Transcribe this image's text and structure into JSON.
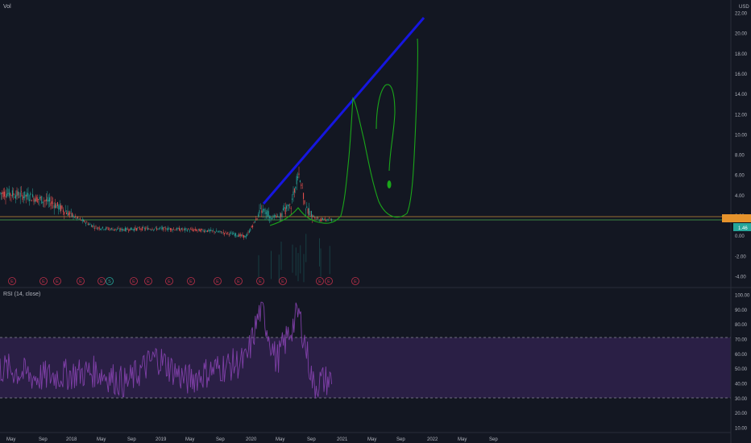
{
  "header": {
    "symbol": "Vol",
    "currency": "USD"
  },
  "price_axis": {
    "labels": [
      "22.00",
      "20.00",
      "18.00",
      "16.00",
      "14.00",
      "12.00",
      "10.00",
      "8.00",
      "6.00",
      "4.00",
      "2.00",
      "0.00",
      "-2.00",
      "-4.00"
    ],
    "current_price_tag": "",
    "current_change_tag": "1.46"
  },
  "rsi": {
    "title": "RSI (14, close)",
    "axis_labels": [
      "100.00",
      "90.00",
      "80.00",
      "70.00",
      "60.00",
      "50.00",
      "40.00",
      "30.00",
      "20.00",
      "10.00"
    ]
  },
  "time_axis": {
    "labels": [
      "May",
      "Sep",
      "2018",
      "May",
      "Sep",
      "2019",
      "May",
      "Sep",
      "2020",
      "May",
      "Sep",
      "2021",
      "May",
      "Sep",
      "2022",
      "May",
      "Sep"
    ]
  },
  "events": {
    "earnings_marker_label": "E",
    "split_marker_label": "S",
    "markers": [
      "E",
      "E",
      "E",
      "E",
      "E",
      "S",
      "E",
      "E",
      "E",
      "E",
      "E",
      "E",
      "E",
      "E",
      "E",
      "E",
      "E"
    ]
  },
  "colors": {
    "background": "#131722",
    "trend_line": "#1616e0",
    "drawing": "#1aa61a",
    "rsi_band": "#2a1f45",
    "rsi_line": "#7e3fa6",
    "up_candle": "#26a69a",
    "down_candle": "#ef5350",
    "marker_red": "#c0304a"
  },
  "chart_data": [
    {
      "type": "candlestick",
      "title": "",
      "ylabel": "USD",
      "ylim": [
        -4,
        22
      ],
      "x_range": [
        "2017-05",
        "2022-10"
      ],
      "grid": false,
      "approx_close_series": {
        "x": [
          "2017-05",
          "2017-08",
          "2017-11",
          "2018-02",
          "2018-05",
          "2018-08",
          "2018-11",
          "2019-02",
          "2019-05",
          "2019-08",
          "2019-11",
          "2020-01",
          "2020-03",
          "2020-05",
          "2020-07",
          "2020-08",
          "2020-09",
          "2020-10",
          "2020-11"
        ],
        "y": [
          4.2,
          3.9,
          3.3,
          1.9,
          0.8,
          0.6,
          0.7,
          0.7,
          0.6,
          0.5,
          0.2,
          -0.1,
          2.5,
          1.8,
          3.0,
          6.5,
          2.6,
          1.9,
          1.6
        ]
      },
      "horizontal_lines": [
        2.0,
        1.5
      ],
      "annotations": [
        "blue rising trend line drawn from 2020 upward to about 21.5",
        "green hand-drawn outline sketch with question mark"
      ]
    },
    {
      "type": "line",
      "title": "RSI (14, close)",
      "ylim": [
        10,
        100
      ],
      "band": [
        30,
        70
      ],
      "approx_series": {
        "x": [
          "2017-05",
          "2017-09",
          "2018-01",
          "2018-05",
          "2018-09",
          "2019-01",
          "2019-05",
          "2019-09",
          "2020-01",
          "2020-03",
          "2020-05",
          "2020-08",
          "2020-10",
          "2020-11"
        ],
        "y": [
          50,
          44,
          46,
          48,
          40,
          58,
          42,
          50,
          55,
          92,
          55,
          88,
          38,
          42
        ]
      }
    }
  ]
}
